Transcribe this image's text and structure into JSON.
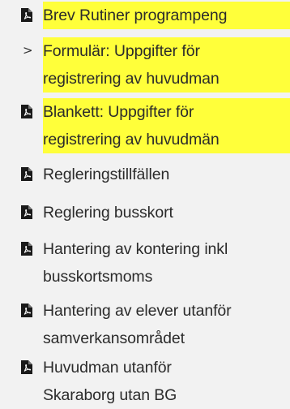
{
  "items": [
    {
      "label_lines": [
        "Brev Rutiner programpeng"
      ],
      "icon": "pdf-icon",
      "highlighted": true
    },
    {
      "label_lines": [
        "Formulär: Uppgifter för",
        "registrering av huvudman"
      ],
      "icon": "chevron-right-icon",
      "marker_text": ">",
      "highlighted": true
    },
    {
      "label_lines": [
        "Blankett: Uppgifter för",
        "registrering av huvudmän"
      ],
      "icon": "pdf-icon",
      "highlighted": true
    },
    {
      "label_lines": [
        "Regleringstillfällen"
      ],
      "icon": "pdf-icon",
      "highlighted": false
    },
    {
      "label_lines": [
        "Reglering busskort"
      ],
      "icon": "pdf-icon",
      "highlighted": false
    },
    {
      "label_lines": [
        "Hantering av kontering inkl",
        "busskortsmoms"
      ],
      "icon": "pdf-icon",
      "highlighted": false
    },
    {
      "label_lines": [
        "Hantering av elever utanför",
        "samverkansområdet"
      ],
      "icon": "pdf-icon",
      "highlighted": false
    },
    {
      "label_lines": [
        "Huvudman utanför",
        "Skaraborg utan BG"
      ],
      "icon": "pdf-icon",
      "highlighted": false
    }
  ],
  "colors": {
    "highlight": "#ffff3a",
    "background": "#f2f2f2",
    "text": "#2b2b2b",
    "icon": "#1a1a1a"
  }
}
